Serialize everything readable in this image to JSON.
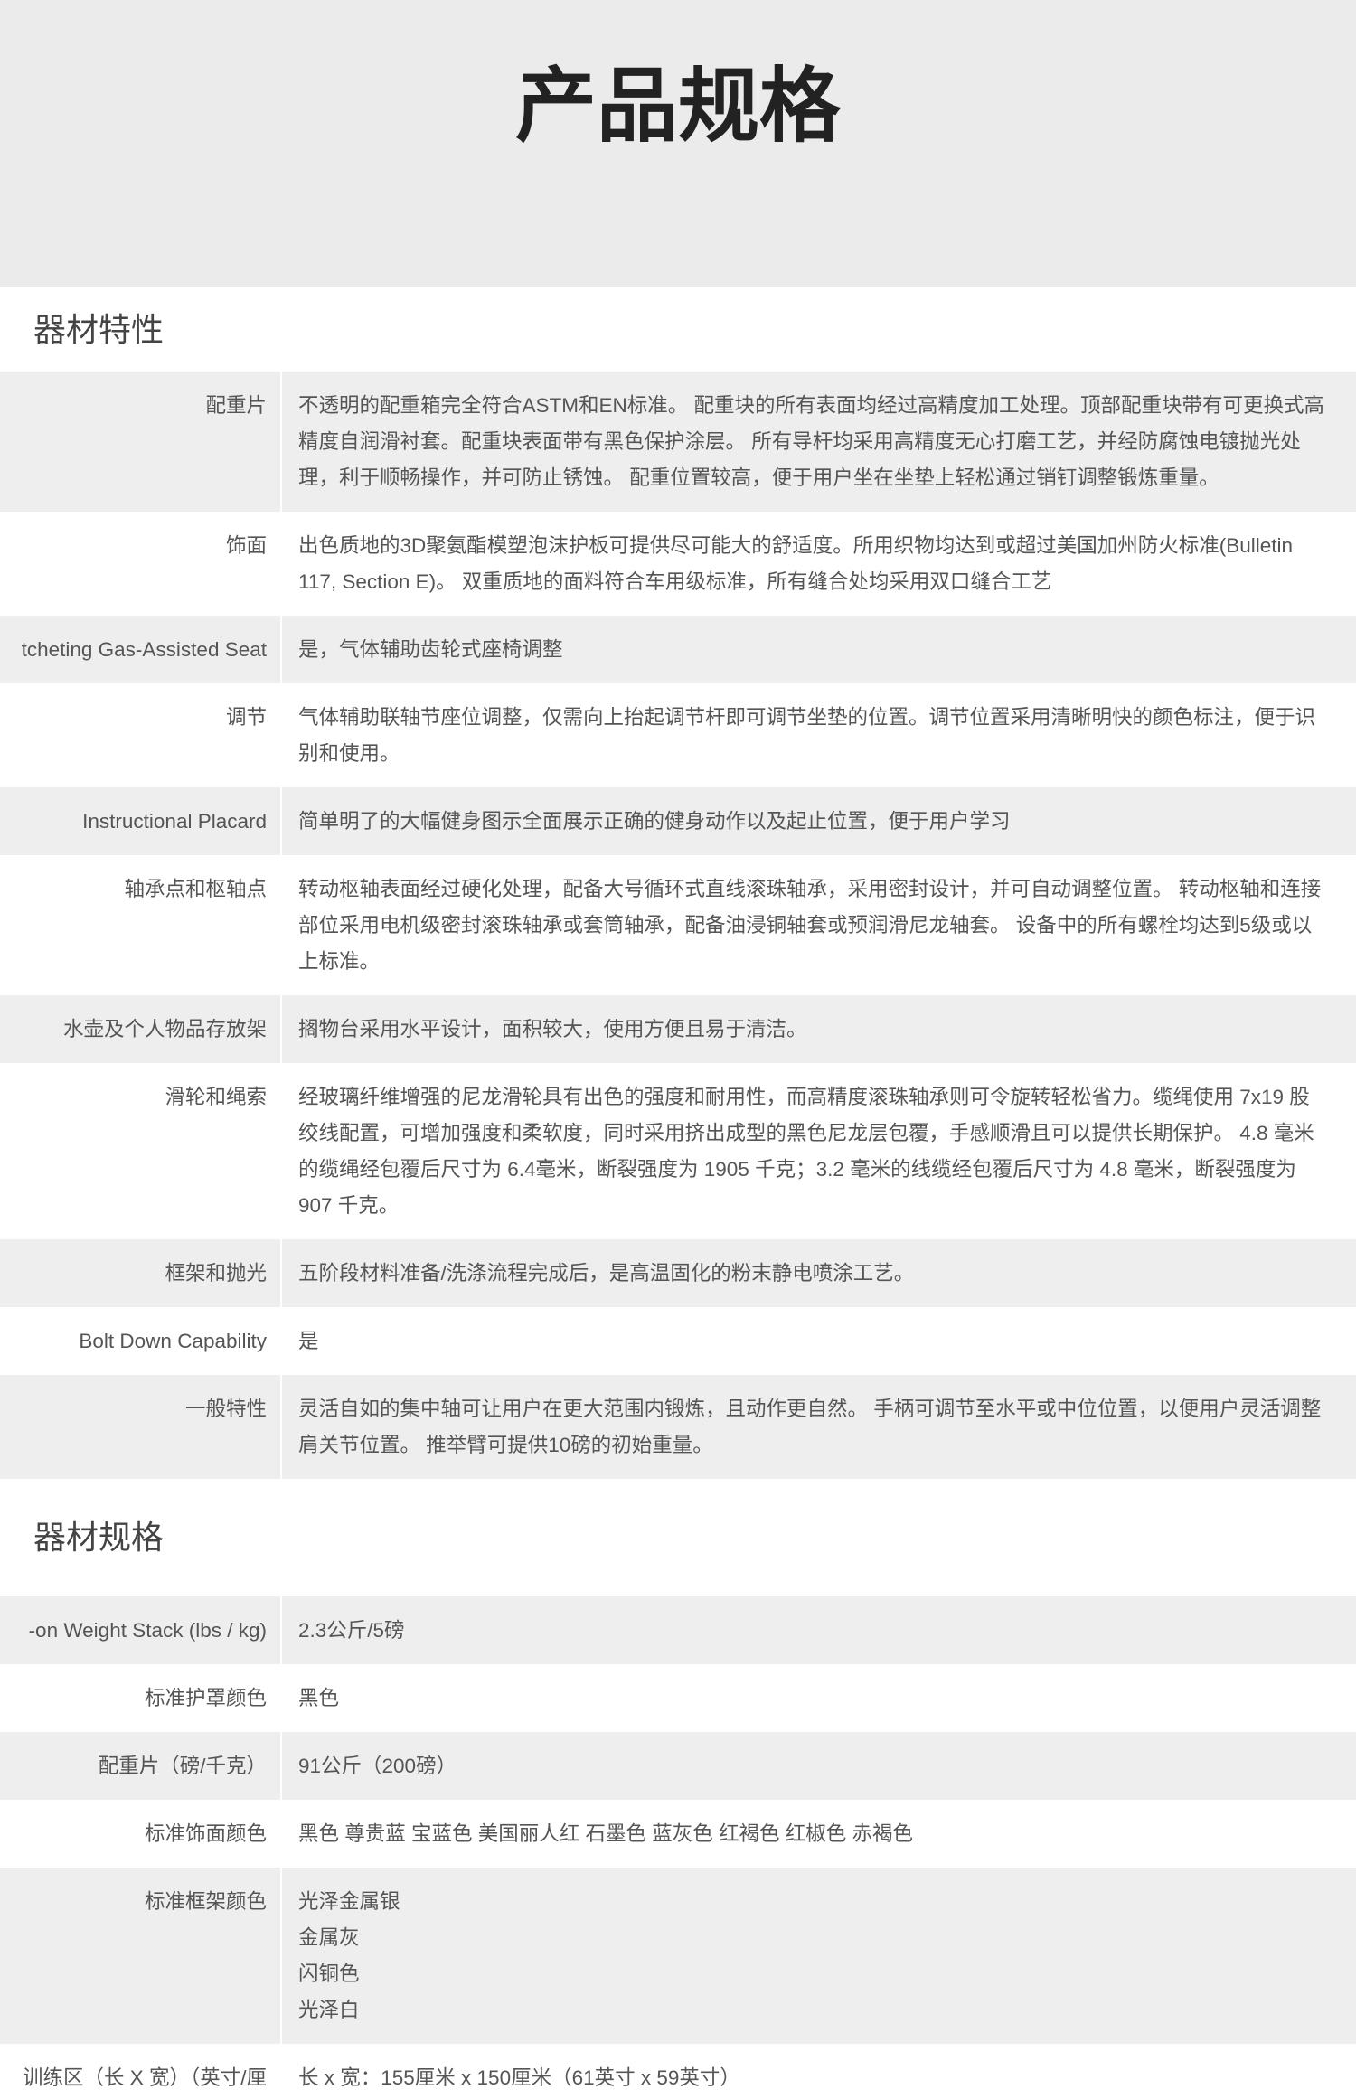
{
  "title": "产品规格",
  "sections": [
    {
      "heading": "器材特性",
      "rows": [
        {
          "label": "配重片",
          "lines": [
            "不透明的配重箱完全符合ASTM和EN标准。 配重块的所有表面均经过高精度加工处理。顶部配重块带有可更换式高",
            "精度自润滑衬套。配重块表面带有黑色保护涂层。 所有导杆均采用高精度无心打磨工艺，并经防腐蚀电镀抛光处",
            "理，利于顺畅操作，并可防止锈蚀。 配重位置较高，便于用户坐在坐垫上轻松通过销钉调整锻炼重量。"
          ]
        },
        {
          "label": "饰面",
          "lines": [
            "出色质地的3D聚氨酯模塑泡沫护板可提供尽可能大的舒适度。所用织物均达到或超过美国加州防火标准(Bulletin",
            "117, Section E)。 双重质地的面料符合车用级标准，所有缝合处均采用双口缝合工艺"
          ]
        },
        {
          "label": "tcheting Gas-Assisted Seat",
          "lines": [
            "是，气体辅助齿轮式座椅调整"
          ]
        },
        {
          "label": "调节",
          "lines": [
            "气体辅助联轴节座位调整，仅需向上抬起调节杆即可调节坐垫的位置。调节位置采用清晰明快的颜色标注，便于识",
            "别和使用。"
          ]
        },
        {
          "label": "Instructional Placard",
          "lines": [
            "简单明了的大幅健身图示全面展示正确的健身动作以及起止位置，便于用户学习"
          ]
        },
        {
          "label": "轴承点和枢轴点",
          "lines": [
            "转动枢轴表面经过硬化处理，配备大号循环式直线滚珠轴承，采用密封设计，并可自动调整位置。 转动枢轴和连接",
            "部位采用电机级密封滚珠轴承或套筒轴承，配备油浸铜轴套或预润滑尼龙轴套。 设备中的所有螺栓均达到5级或以",
            "上标准。"
          ]
        },
        {
          "label": "水壶及个人物品存放架",
          "lines": [
            "搁物台采用水平设计，面积较大，使用方便且易于清洁。"
          ]
        },
        {
          "label": "滑轮和绳索",
          "lines": [
            "经玻璃纤维增强的尼龙滑轮具有出色的强度和耐用性，而高精度滚珠轴承则可令旋转轻松省力。缆绳使用 7x19 股",
            "绞线配置，可增加强度和柔软度，同时采用挤出成型的黑色尼龙层包覆，手感顺滑且可以提供长期保护。 4.8 毫米",
            "的缆绳经包覆后尺寸为 6.4毫米，断裂强度为 1905 千克；3.2 毫米的线缆经包覆后尺寸为 4.8 毫米，断裂强度为",
            "907 千克。"
          ]
        },
        {
          "label": "框架和抛光",
          "lines": [
            "五阶段材料准备/洗涤流程完成后，是高温固化的粉末静电喷涂工艺。"
          ]
        },
        {
          "label": "Bolt Down Capability",
          "lines": [
            "是"
          ]
        },
        {
          "label": "一般特性",
          "lines": [
            "灵活自如的集中轴可让用户在更大范围内锻炼，且动作更自然。 手柄可调节至水平或中位位置，以便用户灵活调整",
            "肩关节位置。 推举臂可提供10磅的初始重量。"
          ]
        }
      ]
    },
    {
      "heading": "器材规格",
      "rows": [
        {
          "label": "-on Weight Stack (lbs / kg)",
          "lines": [
            "2.3公斤/5磅"
          ]
        },
        {
          "label": "标准护罩颜色",
          "lines": [
            "黑色"
          ]
        },
        {
          "label": "配重片（磅/千克）",
          "lines": [
            "91公斤（200磅）"
          ]
        },
        {
          "label": "标准饰面颜色",
          "lines": [
            "黑色 尊贵蓝 宝蓝色 美国丽人红 石墨色 蓝灰色 红褐色 红椒色 赤褐色"
          ]
        },
        {
          "label": "标准框架颜色",
          "lines": [
            "光泽金属银",
            "金属灰",
            "闪铜色",
            "光泽白"
          ]
        },
        {
          "label": "训练区（长 X 宽）（英寸/厘",
          "lines": [
            "长 x 宽：155厘米 x 150厘米（61英寸 x 59英寸）"
          ]
        }
      ]
    }
  ],
  "theme": {
    "header_bg": "#ebebeb",
    "row_alt_bg": "#eeeeee",
    "title_color": "#222222",
    "heading_color": "#444444",
    "text_color": "#555555"
  }
}
